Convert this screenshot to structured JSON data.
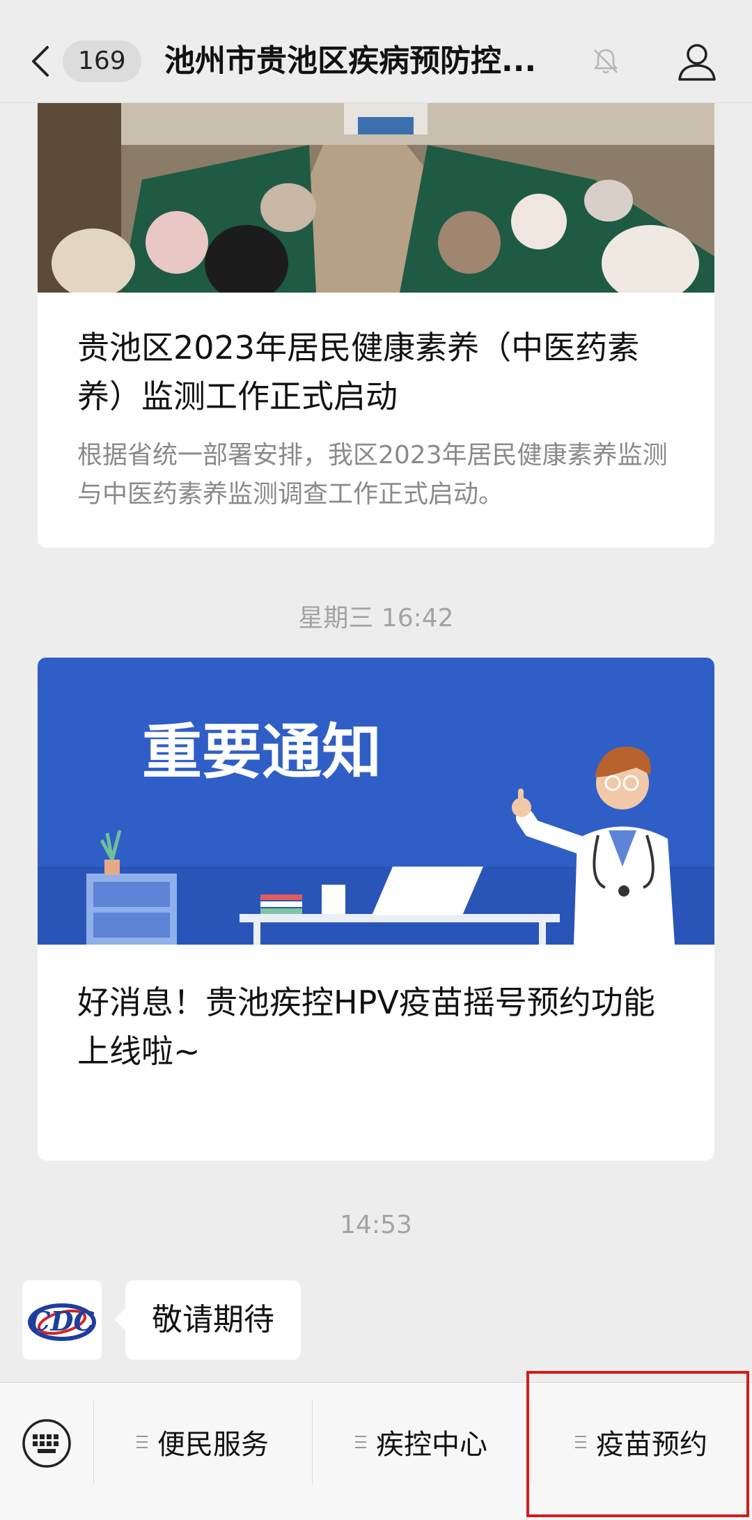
{
  "header": {
    "unread_count": "169",
    "title": "池州市贵池区疾病预防控..."
  },
  "articles": [
    {
      "image": "meeting-room-photo",
      "headline": "贵池区2023年居民健康素养（中医药素养）监测工作正式启动",
      "digest": "根据省统一部署安排，我区2023年居民健康素养监测与中医药素养监测调查工作正式启动。"
    },
    {
      "image": "important-notice-banner",
      "banner_text": "重要通知",
      "headline": "好消息！贵池疾控HPV疫苗摇号预约功能上线啦~"
    }
  ],
  "timestamps": [
    "星期三 16:42",
    "14:53"
  ],
  "message": {
    "avatar_logo": "CDC",
    "text": "敬请期待"
  },
  "menu": {
    "items": [
      "便民服务",
      "疾控中心",
      "疫苗预约"
    ],
    "highlighted": "疫苗预约"
  },
  "colors": {
    "banner_blue": "#2f5fc6",
    "highlight_red": "#d31c1c",
    "background": "#ededed"
  }
}
